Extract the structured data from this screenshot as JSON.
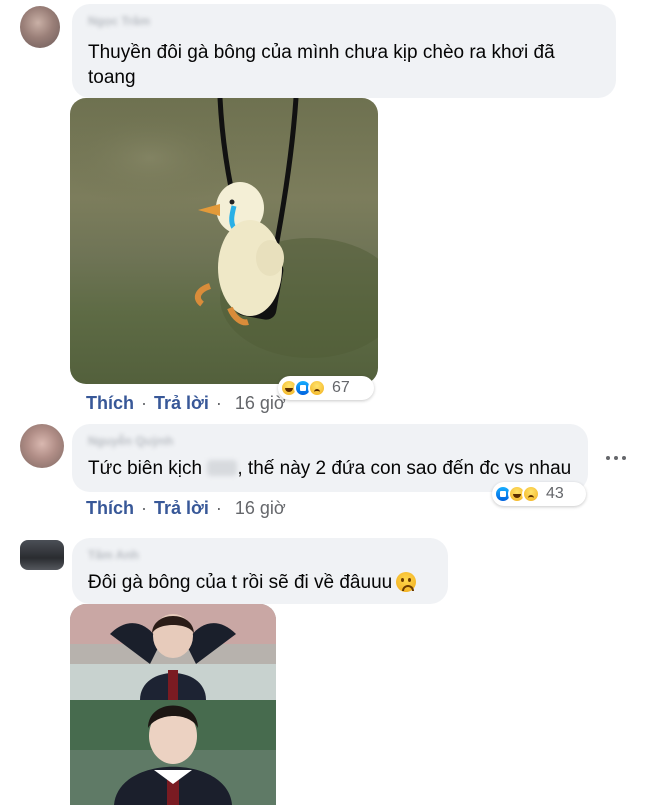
{
  "comments": [
    {
      "author": "Ngọc Trâm",
      "text": "Thuyền đôi gà bông của mình chưa kịp chèo ra khơi đã toang",
      "attachment": "photo-duck",
      "reactions": {
        "icons": [
          "haha-icon",
          "like-icon",
          "sad-icon"
        ],
        "count": "67"
      },
      "actions": {
        "like": "Thích",
        "reply": "Trả lời",
        "separator": "·",
        "time": "16 giờ"
      }
    },
    {
      "author": "Nguyễn Quỳnh",
      "text_before": "Tức biên kịch",
      "text_after": ", thế này 2 đứa con sao đến đc vs nhau",
      "reactions": {
        "icons": [
          "like-icon",
          "haha-icon",
          "sad-icon"
        ],
        "count": "43"
      },
      "actions": {
        "like": "Thích",
        "reply": "Trả lời",
        "separator": "·",
        "time": "16 giờ"
      }
    },
    {
      "author": "Tâm Anh",
      "text": "Đôi gà bông của t rồi sẽ đi về đâuuu",
      "emoji": "sad-face-emoji",
      "attachment": "photo-drama"
    }
  ],
  "colors": {
    "bubble": "#f0f2f5",
    "link": "#385898",
    "meta": "#65676b",
    "text": "#050505"
  }
}
